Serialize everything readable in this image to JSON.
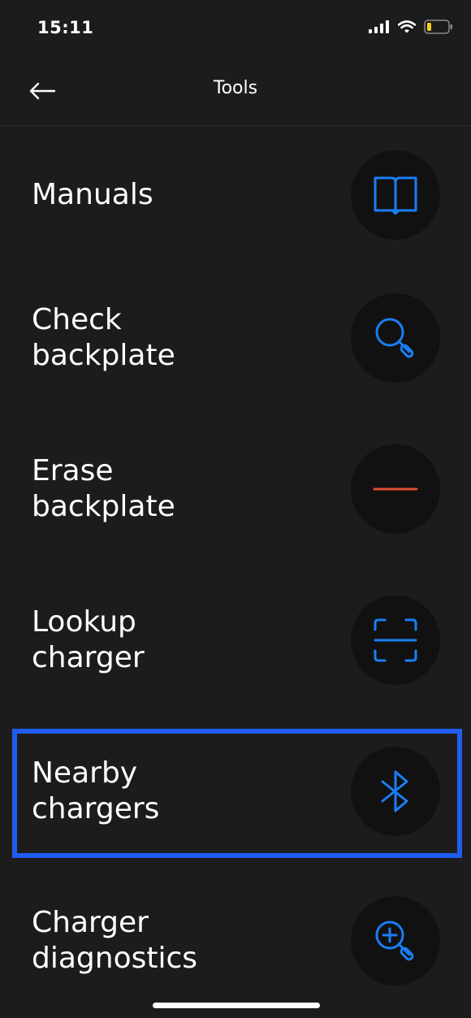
{
  "status_bar": {
    "time": "15:11"
  },
  "nav": {
    "title": "Tools"
  },
  "menu": {
    "items": [
      {
        "label": "Manuals",
        "icon": "book-icon"
      },
      {
        "label": "Check\nbackplate",
        "icon": "magnifier-icon"
      },
      {
        "label": "Erase\nbackplate",
        "icon": "minus-icon"
      },
      {
        "label": "Lookup\ncharger",
        "icon": "scan-icon"
      },
      {
        "label": "Nearby\nchargers",
        "icon": "bluetooth-icon"
      },
      {
        "label": "Charger\ndiagnostics",
        "icon": "zoom-in-icon"
      }
    ]
  },
  "colors": {
    "background": "#1c1c1c",
    "icon_bg": "#111111",
    "accent": "#1a7ef5",
    "danger": "#e04a30",
    "highlight": "#1f5cf0"
  }
}
